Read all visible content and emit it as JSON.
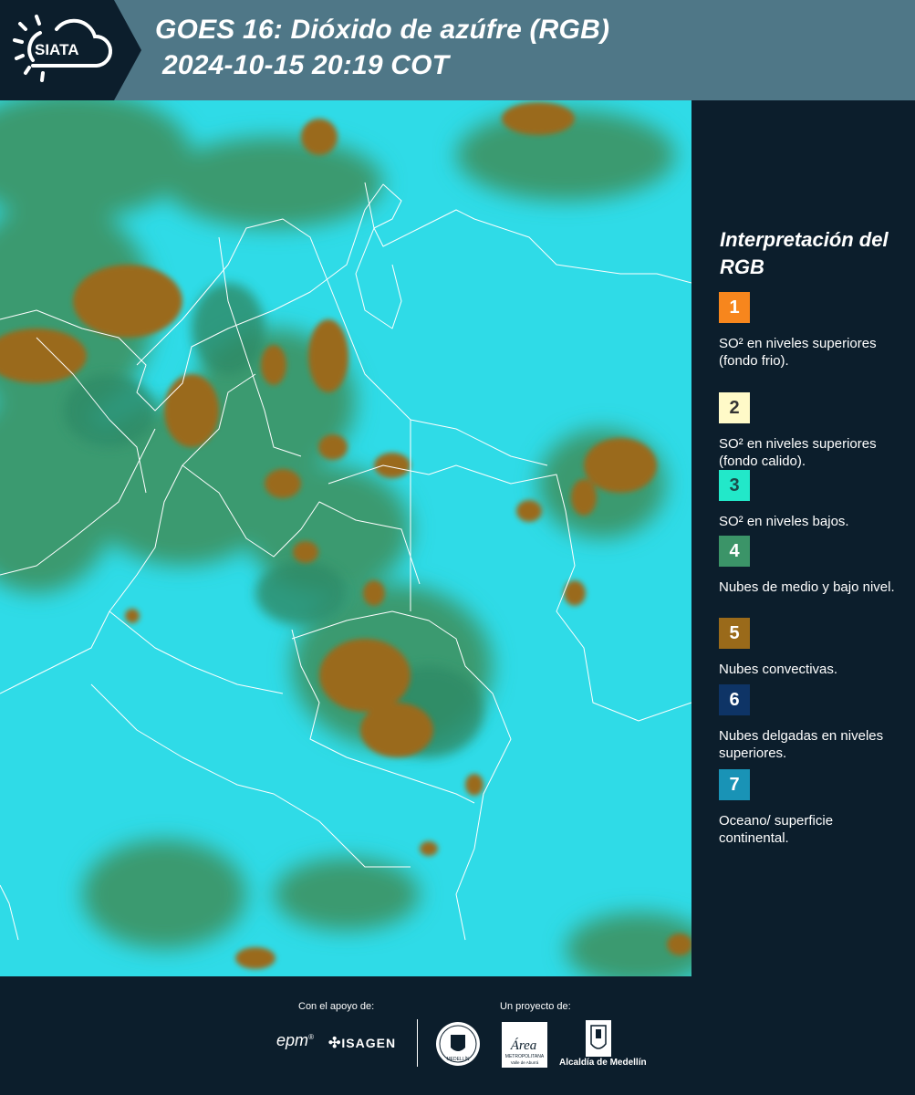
{
  "header": {
    "logo_text": "SIATA",
    "title_line1": "GOES 16: Dióxido de azúfre (RGB)",
    "title_line2": "2024-10-15 20:19 COT"
  },
  "legend": {
    "title": "Interpretación del RGB",
    "items": [
      {
        "number": "1",
        "label": "SO² en niveles superiores (fondo frio).",
        "color": "#f7861d",
        "text_color": "#ffffff"
      },
      {
        "number": "2",
        "label": "SO² en niveles superiores (fondo calido).",
        "color": "#fffac8",
        "text_color": "#333333"
      },
      {
        "number": "3",
        "label": "SO² en niveles bajos.",
        "color": "#22e8c9",
        "text_color": "#1a4a4a"
      },
      {
        "number": "4",
        "label": "Nubes de medio y bajo nivel.",
        "color": "#3b9468",
        "text_color": "#ffffff"
      },
      {
        "number": "5",
        "label": "Nubes convectivas.",
        "color": "#9a6a1a",
        "text_color": "#ffffff"
      },
      {
        "number": "6",
        "label": "Nubes delgadas en niveles superiores.",
        "color": "#0e3466",
        "text_color": "#ffffff"
      },
      {
        "number": "7",
        "label": "Oceano/ superficie continental.",
        "color": "#1993b6",
        "text_color": "#ffffff"
      }
    ]
  },
  "footer": {
    "support_label": "Con el apoyo de:",
    "project_label": "Un proyecto de:",
    "sponsor_epm": "epm",
    "sponsor_isagen": "ISAGEN",
    "partner_medellin_seal": "MEDELLÍN",
    "partner_area": "Área",
    "partner_area_sub": "METROPOLITANA",
    "partner_area_sub2": "Valle de Aburrá",
    "partner_alcaldia": "Alcaldía de Medellín"
  },
  "map": {
    "ocean_color": "#25d8e4",
    "low_cloud_color": "#3b9a70",
    "convective_color": "#9a6a1a",
    "border_color": "#ffffff"
  }
}
